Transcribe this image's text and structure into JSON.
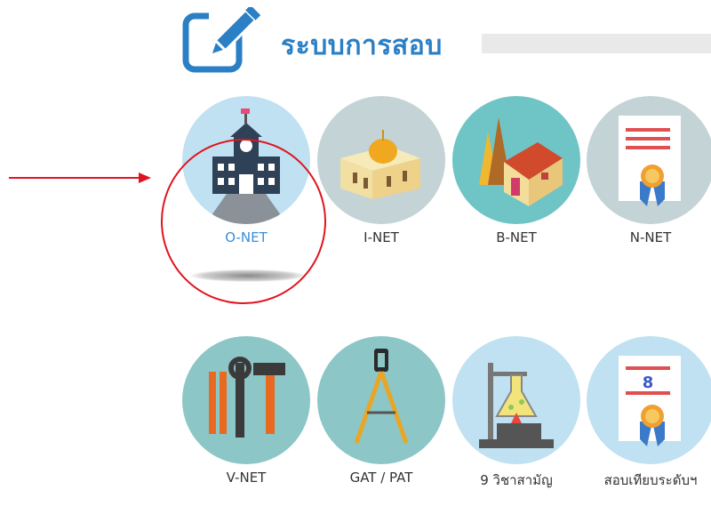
{
  "header": {
    "title": "ระบบการสอบ",
    "icon": "edit-pencil-icon"
  },
  "tiles": [
    {
      "label": "O-NET",
      "icon": "school-building-icon",
      "bg": "#bfe1f2",
      "active": true
    },
    {
      "label": "I-NET",
      "icon": "mosque-icon",
      "bg": "#c3d3d6"
    },
    {
      "label": "B-NET",
      "icon": "temple-house-icon",
      "bg": "#6fc4c6"
    },
    {
      "label": "N-NET",
      "icon": "certificate-ribbon-icon",
      "bg": "#c3d3d6"
    },
    {
      "label": "V-NET",
      "icon": "tools-icon",
      "bg": "#8cc6c7"
    },
    {
      "label": "GAT / PAT",
      "icon": "compass-icon",
      "bg": "#8cc6c7"
    },
    {
      "label": "9 วิชาสามัญ",
      "icon": "lab-flask-icon",
      "bg": "#bfe1f2"
    },
    {
      "label": "สอบเทียบระดับฯ",
      "icon": "certificate-8-icon",
      "bg": "#bfe1f2"
    }
  ],
  "certificate_number": "8",
  "colors": {
    "accent": "#2a7fc5",
    "active_label": "#3a8fd6",
    "highlight": "#e0141e"
  }
}
